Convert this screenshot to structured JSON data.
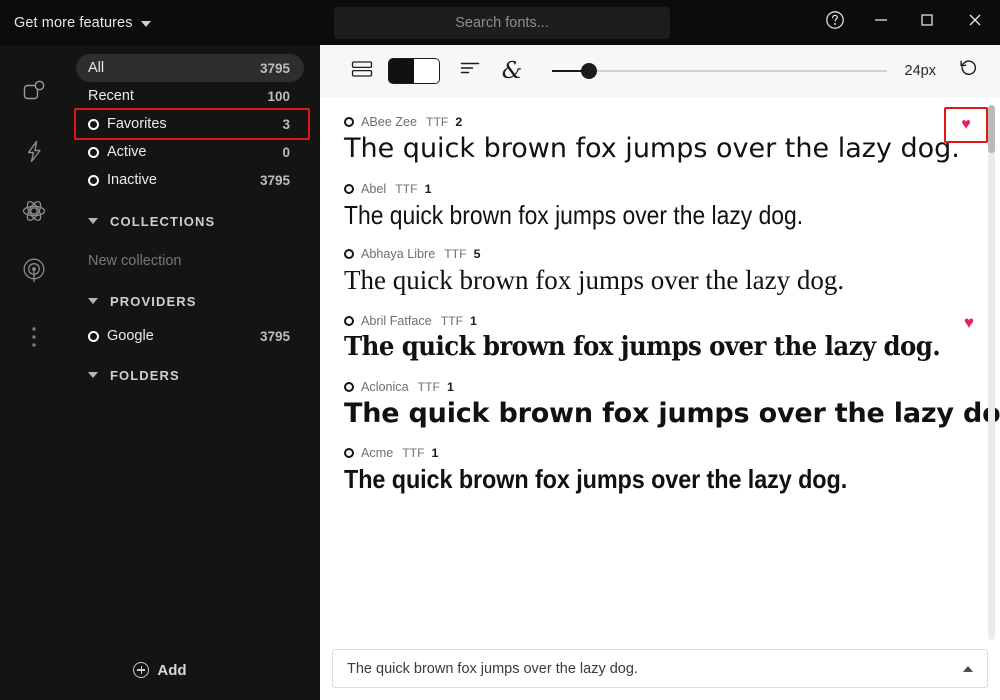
{
  "promo": {
    "label": "Get more features",
    "icon": "chevron-down-icon"
  },
  "titlebar": {
    "search_placeholder": "Search fonts...",
    "help_icon": "help-circle-icon",
    "minimize_icon": "minimize-icon",
    "maximize_icon": "maximize-icon",
    "close_icon": "close-icon"
  },
  "rail": {
    "items": [
      {
        "icon": "fonts-square-badge-icon",
        "name": "rail-item-fonts"
      },
      {
        "icon": "lightning-bolt-icon",
        "name": "rail-item-activate"
      },
      {
        "icon": "atom-icon",
        "name": "rail-item-playground"
      },
      {
        "icon": "broadcast-radar-icon",
        "name": "rail-item-sync"
      }
    ],
    "more_icon": "more-vertical-icon"
  },
  "sidebar": {
    "filters": [
      {
        "label": "All",
        "count": "3795",
        "ring": false,
        "selected": true
      },
      {
        "label": "Recent",
        "count": "100",
        "ring": false,
        "selected": false
      },
      {
        "label": "Favorites",
        "count": "3",
        "ring": true,
        "selected": false,
        "highlighted": true
      },
      {
        "label": "Active",
        "count": "0",
        "ring": true,
        "selected": false
      },
      {
        "label": "Inactive",
        "count": "3795",
        "ring": true,
        "selected": false
      }
    ],
    "sections": {
      "collections_title": "COLLECTIONS",
      "new_collection": "New collection",
      "providers_title": "PROVIDERS",
      "folders_title": "FOLDERS"
    },
    "providers": [
      {
        "label": "Google",
        "count": "3795"
      }
    ],
    "add_label": "Add",
    "add_icon": "plus-circle-icon"
  },
  "toolbar": {
    "list_view_icon": "list-rows-icon",
    "bw_toggle_icon": "black-white-toggle-icon",
    "align_icon": "text-align-left-icon",
    "ampersand_icon": "ampersand-glyph-icon",
    "size_value": "24px",
    "slider_percent": 11,
    "reset_icon": "reset-rotate-left-icon"
  },
  "fonts": [
    {
      "name": "ABee Zee",
      "format": "TTF",
      "count": "2",
      "sample": "The quick brown fox jumps over the lazy dog.",
      "style": "f-abeezee",
      "favorite": true,
      "favorite_boxed": true
    },
    {
      "name": "Abel",
      "format": "TTF",
      "count": "1",
      "sample": "The quick brown fox jumps over the lazy dog.",
      "style": "f-abel",
      "favorite": false,
      "favorite_boxed": false
    },
    {
      "name": "Abhaya Libre",
      "format": "TTF",
      "count": "5",
      "sample": "The quick brown fox jumps over the lazy dog.",
      "style": "f-abhaya",
      "favorite": false,
      "favorite_boxed": false
    },
    {
      "name": "Abril Fatface",
      "format": "TTF",
      "count": "1",
      "sample": "The quick brown fox jumps over the lazy dog.",
      "style": "f-abril",
      "favorite": true,
      "favorite_boxed": false
    },
    {
      "name": "Aclonica",
      "format": "TTF",
      "count": "1",
      "sample": "The quick brown fox jumps over the lazy dog.",
      "style": "f-aclonica",
      "favorite": false,
      "favorite_boxed": false
    },
    {
      "name": "Acme",
      "format": "TTF",
      "count": "1",
      "sample": "The quick brown fox jumps over the lazy dog.",
      "style": "f-acme",
      "favorite": false,
      "favorite_boxed": false
    }
  ],
  "preview": {
    "text": "The quick brown fox jumps over the lazy dog.",
    "collapse_icon": "caret-up-icon"
  },
  "colors": {
    "panel_dark": "#141414",
    "titlebar_dark": "#0c0c0c",
    "pill_selected": "#2e2e2e",
    "highlight_red": "#e01717",
    "heart_pink": "#e8205c",
    "toolbar_bg": "#f7f7f7"
  }
}
